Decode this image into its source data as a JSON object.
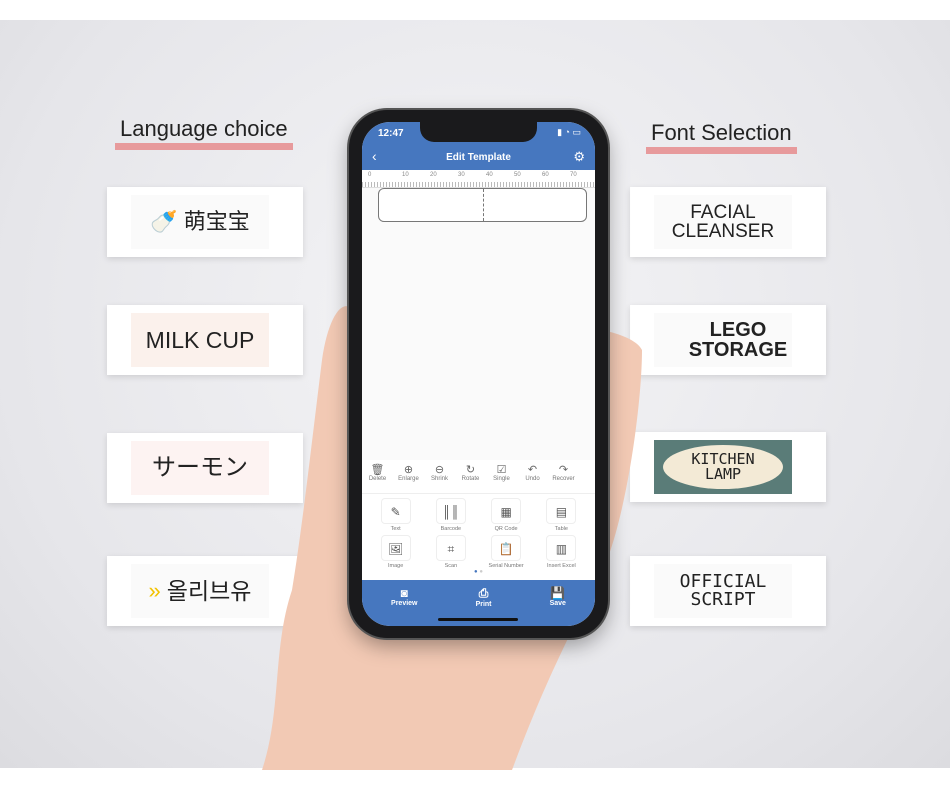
{
  "left": {
    "heading": "Language choice",
    "labels": [
      "萌宝宝",
      "MILK CUP",
      "サーモン",
      "올리브유"
    ]
  },
  "right": {
    "heading": "Font Selection",
    "labels": [
      [
        "FACIAL",
        "CLEANSER"
      ],
      [
        "LEGO",
        "STORAGE"
      ],
      [
        "KITCHEN",
        "LAMP"
      ],
      [
        "OFFICIAL",
        "SCRIPT"
      ]
    ]
  },
  "phone": {
    "time": "12:47",
    "title": "Edit Template",
    "ruler": [
      "0",
      "10",
      "20",
      "30",
      "40",
      "50",
      "60",
      "70"
    ],
    "toolbar": [
      "Delete",
      "Enlarge",
      "Shrink",
      "Rotate",
      "Single",
      "Undo",
      "Recover"
    ],
    "tools": [
      "Text",
      "Barcode",
      "QR Code",
      "Table",
      "Image",
      "Scan",
      "Serial Number",
      "Insert Excel"
    ],
    "bottom": [
      "Preview",
      "Print",
      "Save"
    ]
  },
  "colors": {
    "accent": "#4677bf",
    "underline": "#e79a9c"
  }
}
